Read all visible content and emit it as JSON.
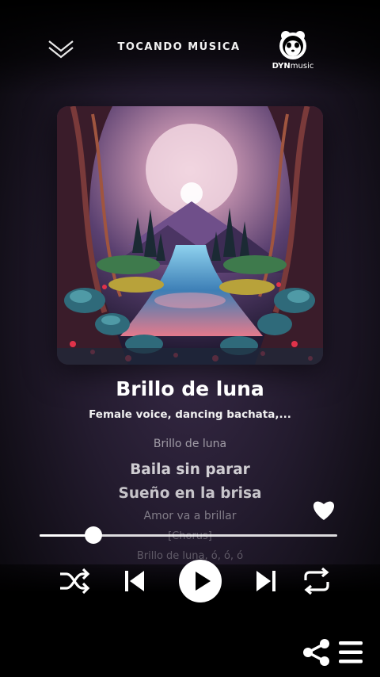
{
  "header": {
    "title": "TOCANDO MÚSICA",
    "logo_text_bold": "DYN",
    "logo_text_light": "music"
  },
  "track": {
    "title": "Brillo de luna",
    "subtitle": "Female voice, dancing bachata,..."
  },
  "lyrics": [
    "Brillo de luna",
    "Baila sin parar",
    "Sueño en la brisa",
    "Amor va a brillar",
    "[Chorus]",
    "Brillo de luna, ó, ó, ó"
  ],
  "player": {
    "progress": 0.18,
    "favorited": true,
    "playing": false
  },
  "colors": {
    "accent": "#ffffff",
    "background": "#231b2e"
  },
  "icons": {
    "collapse": "chevron-down-double-icon",
    "shuffle": "shuffle-icon",
    "previous": "skip-previous-icon",
    "play": "play-icon",
    "next": "skip-next-icon",
    "repeat": "repeat-icon",
    "favorite": "heart-icon",
    "share": "share-icon",
    "menu": "menu-icon"
  }
}
